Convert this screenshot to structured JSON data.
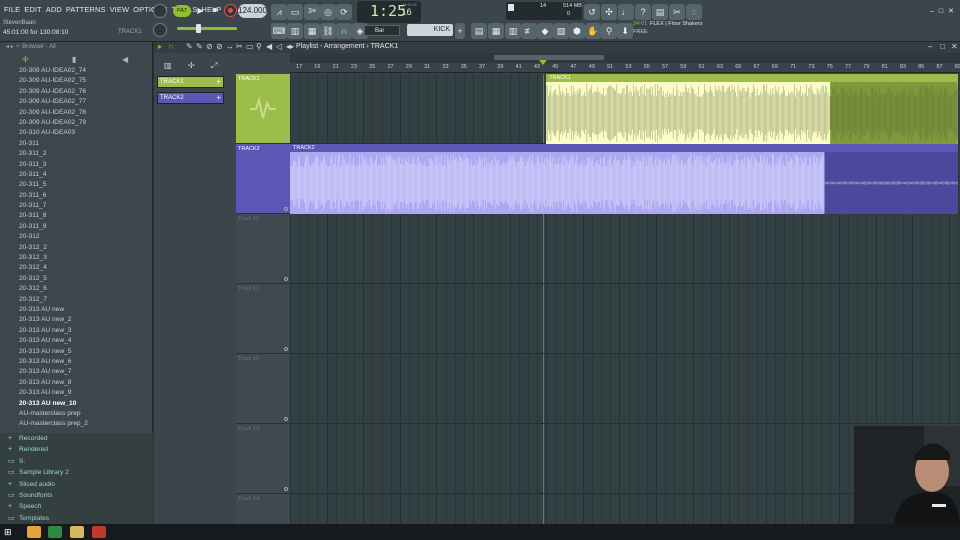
{
  "menu": [
    "FILE",
    "EDIT",
    "ADD",
    "PATTERNS",
    "VIEW",
    "OPTIONS",
    "TOOLS",
    "HELP"
  ],
  "project": {
    "user": "StevenBaan",
    "time": "45:01:00 for 130:08:10",
    "track": "TRACK1"
  },
  "transport": {
    "pattern_label": "PAT",
    "tempo": "124.000",
    "time": "1:25",
    "time_sub": "16",
    "time_unit": "M:S:CS"
  },
  "cpu": {
    "voices": "14",
    "memory": "514 MB",
    "zero": "0"
  },
  "snap": {
    "value": "Bar"
  },
  "pattern_selector": {
    "value": "KICK"
  },
  "hint": {
    "number": "24-01",
    "title": "FLEX | Floor Shakers",
    "sub": "FREE"
  },
  "browser": {
    "title": "Browser - All",
    "items": [
      "20-309 AU-IDEA02_74",
      "20-309 AU-IDEA02_75",
      "20-309 AU-IDEA02_76",
      "20-309 AU-IDEA02_77",
      "20-309 AU-IDEA02_78",
      "20-309 AU-IDEA02_79",
      "20-310 AU-IDEA03",
      "20-311",
      "20-311_2",
      "20-311_3",
      "20-311_4",
      "20-311_5",
      "20-311_6",
      "20-311_7",
      "20-311_8",
      "20-311_9",
      "20-312",
      "20-312_2",
      "20-312_3",
      "20-312_4",
      "20-312_5",
      "20-312_6",
      "20-312_7",
      "20-313 AU new",
      "20-313 AU new_2",
      "20-313 AU new_3",
      "20-313 AU new_4",
      "20-313 AU new_5",
      "20-313 AU new_6",
      "20-313 AU new_7",
      "20-313 AU new_8",
      "20-313 AU new_9",
      "20-313 AU new_10",
      "AU-masterclass prep",
      "AU-masterclass prep_2"
    ],
    "active_index": 32,
    "folders": [
      {
        "label": "Recorded",
        "icon": "plus-folder-icon"
      },
      {
        "label": "Rendered",
        "icon": "plus-folder-icon"
      },
      {
        "label": "S:",
        "icon": "folder-icon"
      },
      {
        "label": "Sample Library 2",
        "icon": "folder-icon"
      },
      {
        "label": "Sliced audio",
        "icon": "plus-folder-icon"
      },
      {
        "label": "Soundfonts",
        "icon": "folder-icon"
      },
      {
        "label": "Speech",
        "icon": "plus-folder-icon"
      },
      {
        "label": "Templates",
        "icon": "folder-icon"
      }
    ]
  },
  "playlist": {
    "title": "Playlist - Arrangement",
    "selected": "TRACK1",
    "picker": [
      "TRACK1",
      "TRACK2"
    ],
    "ruler": [
      "17",
      "19",
      "21",
      "23",
      "25",
      "27",
      "29",
      "31",
      "33",
      "35",
      "37",
      "39",
      "41",
      "43",
      "45",
      "47",
      "49",
      "51",
      "53",
      "55",
      "57",
      "59",
      "61",
      "63",
      "65",
      "67",
      "69",
      "71",
      "73",
      "75",
      "77",
      "79",
      "81",
      "83",
      "85",
      "87",
      "89"
    ],
    "tracks": [
      {
        "name": "TRACK1",
        "color": "#9dbd4a"
      },
      {
        "name": "TRACK2",
        "color": "#5a57b5"
      },
      {
        "name": "Track 10",
        "color": ""
      },
      {
        "name": "Track 11",
        "color": ""
      },
      {
        "name": "Track 12",
        "color": ""
      },
      {
        "name": "Track 13",
        "color": ""
      },
      {
        "name": "Track 14",
        "color": ""
      }
    ],
    "clips": [
      {
        "name": "TRACK1",
        "track": 0,
        "start": 45,
        "end": 89,
        "head": "#9dbd4a",
        "body": "#fbfcc7",
        "wave": "#5b6730"
      },
      {
        "name": "TRACK2",
        "track": 1,
        "start": 17,
        "end": 89,
        "head": "#5a57b5",
        "body": "#aca8f2",
        "wave": "#ffffff"
      }
    ]
  },
  "colors": {
    "accent": "#8fbf2f"
  }
}
